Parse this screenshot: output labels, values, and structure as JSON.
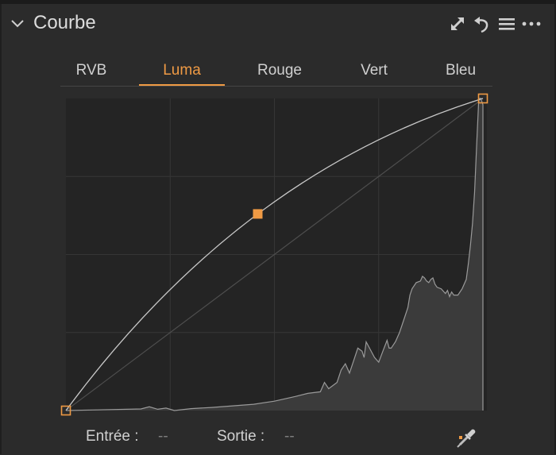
{
  "panel": {
    "title": "Courbe",
    "collapse_icon": "chevron-down-icon",
    "header_icons": [
      "expand-icon",
      "reset-undo-icon",
      "presets-menu-icon",
      "more-options-icon"
    ]
  },
  "tabs": [
    {
      "label": "RVB",
      "active": false
    },
    {
      "label": "Luma",
      "active": true
    },
    {
      "label": "Rouge",
      "active": false
    },
    {
      "label": "Vert",
      "active": false
    },
    {
      "label": "Bleu",
      "active": false
    }
  ],
  "curve": {
    "control_points": [
      {
        "input": 0,
        "output": 0,
        "style": "hollow"
      },
      {
        "input": 0.46,
        "output": 0.63,
        "style": "filled"
      },
      {
        "input": 1.0,
        "output": 1.0,
        "style": "hollow"
      }
    ],
    "histogram": [
      [
        0.0,
        0.0
      ],
      [
        0.18,
        0.005
      ],
      [
        0.2,
        0.012
      ],
      [
        0.22,
        0.004
      ],
      [
        0.24,
        0.008
      ],
      [
        0.26,
        0.0
      ],
      [
        0.3,
        0.006
      ],
      [
        0.35,
        0.01
      ],
      [
        0.4,
        0.015
      ],
      [
        0.45,
        0.02
      ],
      [
        0.5,
        0.03
      ],
      [
        0.55,
        0.045
      ],
      [
        0.58,
        0.055
      ],
      [
        0.61,
        0.06
      ],
      [
        0.62,
        0.09
      ],
      [
        0.63,
        0.07
      ],
      [
        0.65,
        0.09
      ],
      [
        0.66,
        0.13
      ],
      [
        0.67,
        0.15
      ],
      [
        0.68,
        0.12
      ],
      [
        0.69,
        0.16
      ],
      [
        0.7,
        0.2
      ],
      [
        0.71,
        0.19
      ],
      [
        0.715,
        0.17
      ],
      [
        0.72,
        0.22
      ],
      [
        0.73,
        0.195
      ],
      [
        0.74,
        0.17
      ],
      [
        0.75,
        0.155
      ],
      [
        0.76,
        0.19
      ],
      [
        0.77,
        0.225
      ],
      [
        0.775,
        0.2
      ],
      [
        0.78,
        0.2
      ],
      [
        0.79,
        0.22
      ],
      [
        0.8,
        0.25
      ],
      [
        0.81,
        0.29
      ],
      [
        0.82,
        0.33
      ],
      [
        0.825,
        0.37
      ],
      [
        0.83,
        0.39
      ],
      [
        0.84,
        0.41
      ],
      [
        0.85,
        0.415
      ],
      [
        0.855,
        0.43
      ],
      [
        0.86,
        0.425
      ],
      [
        0.865,
        0.415
      ],
      [
        0.87,
        0.41
      ],
      [
        0.875,
        0.42
      ],
      [
        0.88,
        0.425
      ],
      [
        0.885,
        0.405
      ],
      [
        0.89,
        0.395
      ],
      [
        0.9,
        0.39
      ],
      [
        0.91,
        0.375
      ],
      [
        0.915,
        0.385
      ],
      [
        0.92,
        0.365
      ],
      [
        0.925,
        0.38
      ],
      [
        0.93,
        0.37
      ],
      [
        0.94,
        0.37
      ],
      [
        0.95,
        0.39
      ],
      [
        0.96,
        0.42
      ],
      [
        0.965,
        0.47
      ],
      [
        0.97,
        0.53
      ],
      [
        0.975,
        0.6
      ],
      [
        0.98,
        0.7
      ],
      [
        0.985,
        0.85
      ],
      [
        0.99,
        1.0
      ],
      [
        0.995,
        1.0
      ],
      [
        1.0,
        0.98
      ]
    ],
    "accent_color": "#ef9a44",
    "curve_color": "#c8c8c8",
    "histogram_color": "#3b3b3b"
  },
  "footer": {
    "input_label": "Entrée :",
    "input_value": "--",
    "output_label": "Sortie :",
    "output_value": "--",
    "picker_icon": "eyedropper-picker-icon"
  }
}
